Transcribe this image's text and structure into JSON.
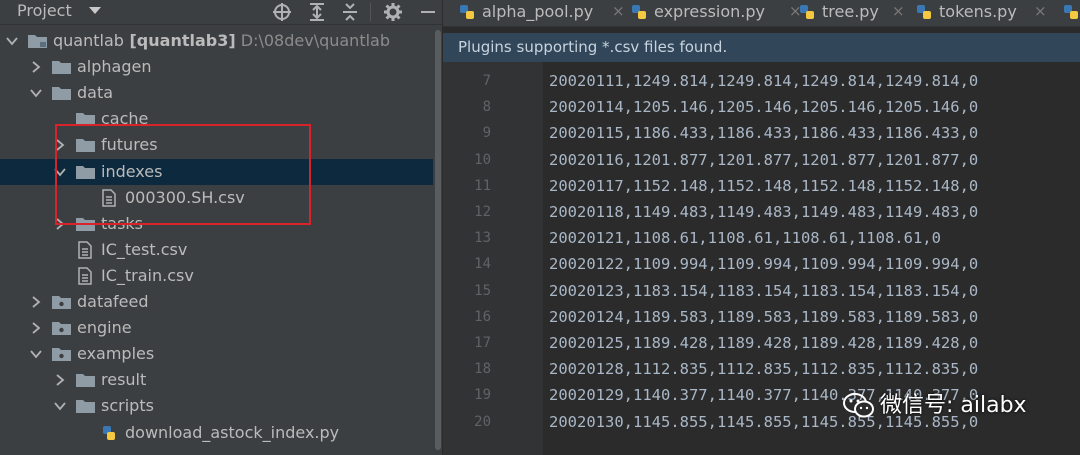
{
  "project_panel": {
    "title": "Project",
    "icons": [
      "crosshair-icon",
      "expand-all-icon",
      "collapse-all-icon",
      "settings-gear-icon",
      "hide-panel-icon"
    ],
    "tree": [
      {
        "label": "quantlab",
        "bold_part": "[quantlab3]",
        "path": "D:\\08dev\\quantlab",
        "kind": "module-folder",
        "expanded": true
      },
      {
        "label": "alphagen",
        "kind": "folder",
        "expanded": false
      },
      {
        "label": "data",
        "kind": "folder",
        "expanded": true
      },
      {
        "label": "cache",
        "kind": "folder"
      },
      {
        "label": "futures",
        "kind": "folder",
        "expanded": false
      },
      {
        "label": "indexes",
        "kind": "folder",
        "expanded": true,
        "selected": true
      },
      {
        "label": "000300.SH.csv",
        "kind": "file"
      },
      {
        "label": "tasks",
        "kind": "folder",
        "expanded": false
      },
      {
        "label": "IC_test.csv",
        "kind": "file"
      },
      {
        "label": "IC_train.csv",
        "kind": "file"
      },
      {
        "label": "datafeed",
        "kind": "package",
        "expanded": false
      },
      {
        "label": "engine",
        "kind": "package",
        "expanded": false
      },
      {
        "label": "examples",
        "kind": "package",
        "expanded": true
      },
      {
        "label": "result",
        "kind": "folder",
        "expanded": false
      },
      {
        "label": "scripts",
        "kind": "folder",
        "expanded": true
      },
      {
        "label": "download_astock_index.py",
        "kind": "python-file"
      }
    ]
  },
  "editor": {
    "tabs": [
      {
        "name": "alpha_pool.py",
        "close": "×"
      },
      {
        "name": "expression.py",
        "close": "×"
      },
      {
        "name": "tree.py",
        "close": "×"
      },
      {
        "name": "tokens.py",
        "close": "×"
      }
    ],
    "notice": "Plugins supporting *.csv files found.",
    "lines": [
      {
        "n": "7",
        "text": "20020111,1249.814,1249.814,1249.814,1249.814,0"
      },
      {
        "n": "8",
        "text": "20020114,1205.146,1205.146,1205.146,1205.146,0"
      },
      {
        "n": "9",
        "text": "20020115,1186.433,1186.433,1186.433,1186.433,0"
      },
      {
        "n": "10",
        "text": "20020116,1201.877,1201.877,1201.877,1201.877,0"
      },
      {
        "n": "11",
        "text": "20020117,1152.148,1152.148,1152.148,1152.148,0"
      },
      {
        "n": "12",
        "text": "20020118,1149.483,1149.483,1149.483,1149.483,0"
      },
      {
        "n": "13",
        "text": "20020121,1108.61,1108.61,1108.61,1108.61,0"
      },
      {
        "n": "14",
        "text": "20020122,1109.994,1109.994,1109.994,1109.994,0"
      },
      {
        "n": "15",
        "text": "20020123,1183.154,1183.154,1183.154,1183.154,0"
      },
      {
        "n": "16",
        "text": "20020124,1189.583,1189.583,1189.583,1189.583,0"
      },
      {
        "n": "17",
        "text": "20020125,1189.428,1189.428,1189.428,1189.428,0"
      },
      {
        "n": "18",
        "text": "20020128,1112.835,1112.835,1112.835,1112.835,0"
      },
      {
        "n": "19",
        "text": "20020129,1140.377,1140.377,1140.377,1140.377,0"
      },
      {
        "n": "20",
        "text": "20020130,1145.855,1145.855,1145.855,1145.855,0"
      }
    ]
  },
  "watermark": "微信号: ailabx",
  "colors": {
    "highlight_box": "#d8232a",
    "selection": "#0d293e",
    "notice_bg": "#32465a"
  }
}
